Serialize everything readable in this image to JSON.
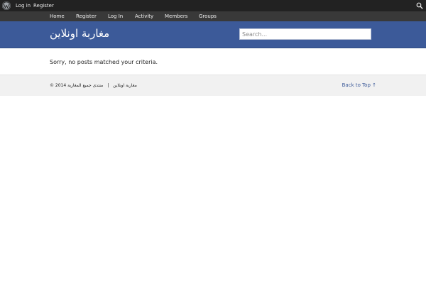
{
  "admin_bar": {
    "login_label": "Log in",
    "register_label": "Register"
  },
  "nav": {
    "items": [
      {
        "label": "Home"
      },
      {
        "label": "Register"
      },
      {
        "label": "Log In"
      },
      {
        "label": "Activity"
      },
      {
        "label": "Members"
      },
      {
        "label": "Groups"
      }
    ]
  },
  "header": {
    "site_title": "مغاربة اونلاين",
    "search_placeholder": "Search..."
  },
  "main": {
    "message": "Sorry, no posts matched your criteria."
  },
  "footer": {
    "copyright": "© 2014",
    "forum_name": "منتدى جميع المغاربة",
    "separator": "|",
    "site_name": "مغاربة اونلاين",
    "back_to_top": "Back to Top ↑"
  },
  "colors": {
    "admin_bar": "#222222",
    "nav_bar": "#393939",
    "header": "#3c5a99",
    "footer": "#f1f1f1",
    "link": "#3c5a99"
  }
}
